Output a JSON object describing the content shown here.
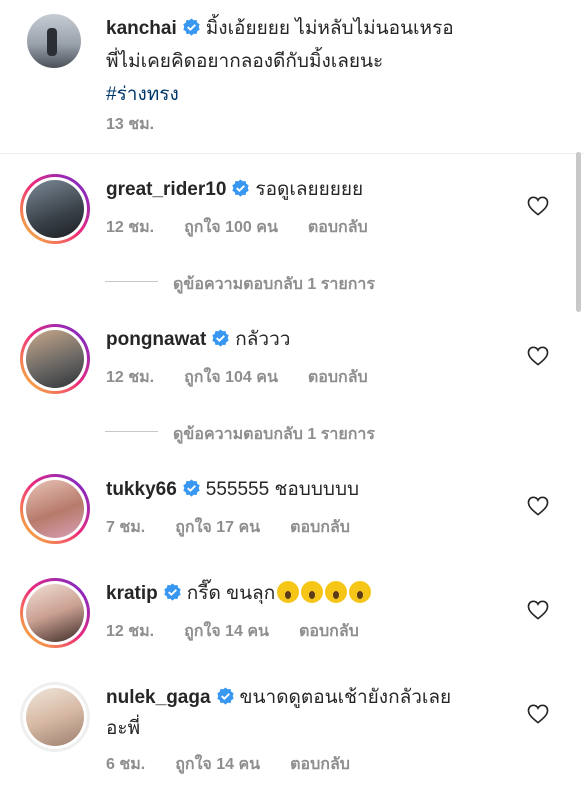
{
  "caption": {
    "username": "kanchai",
    "text_line1": "มิ้งเอ้ยยยย ไม่หลับไม่นอนเหรอ",
    "text_line2": "พี่ไม่เคยคิดอยากลองดีกับมิ้งเลยนะ",
    "hashtag": "#ร่างทรง",
    "time": "13 ชม."
  },
  "comments": [
    {
      "username": "great_rider10",
      "text": "รอดูเลยยยยย",
      "time": "12 ชม.",
      "likes": "ถูกใจ 100 คน",
      "reply": "ตอบกลับ",
      "view_replies": "ดูข้อความตอบกลับ 1 รายการ"
    },
    {
      "username": "pongnawat",
      "text": "กลัววว",
      "time": "12 ชม.",
      "likes": "ถูกใจ 104 คน",
      "reply": "ตอบกลับ",
      "view_replies": "ดูข้อความตอบกลับ 1 รายการ"
    },
    {
      "username": "tukky66",
      "text": "555555 ชอบบบบบ",
      "time": "7 ชม.",
      "likes": "ถูกใจ 17 คน",
      "reply": "ตอบกลับ"
    },
    {
      "username": "kratip",
      "text": "กรี๊ด ขนลุก",
      "emoji_count": 4,
      "time": "12 ชม.",
      "likes": "ถูกใจ 14 คน",
      "reply": "ตอบกลับ"
    },
    {
      "username": "nulek_gaga",
      "text_line1": "ขนาดดูตอนเช้ายังกลัวเลย",
      "text_line2": "อะพี่",
      "time": "6 ชม.",
      "likes": "ถูกใจ 14 คน",
      "reply": "ตอบกลับ"
    }
  ],
  "icons": {
    "verified": "verified-badge-icon",
    "like": "heart-outline-icon",
    "emoji": "screaming-face-emoji"
  },
  "colors": {
    "verified": "#3897f0",
    "meta": "#8e8e8e",
    "text": "#262626",
    "hashtag": "#00376b"
  }
}
